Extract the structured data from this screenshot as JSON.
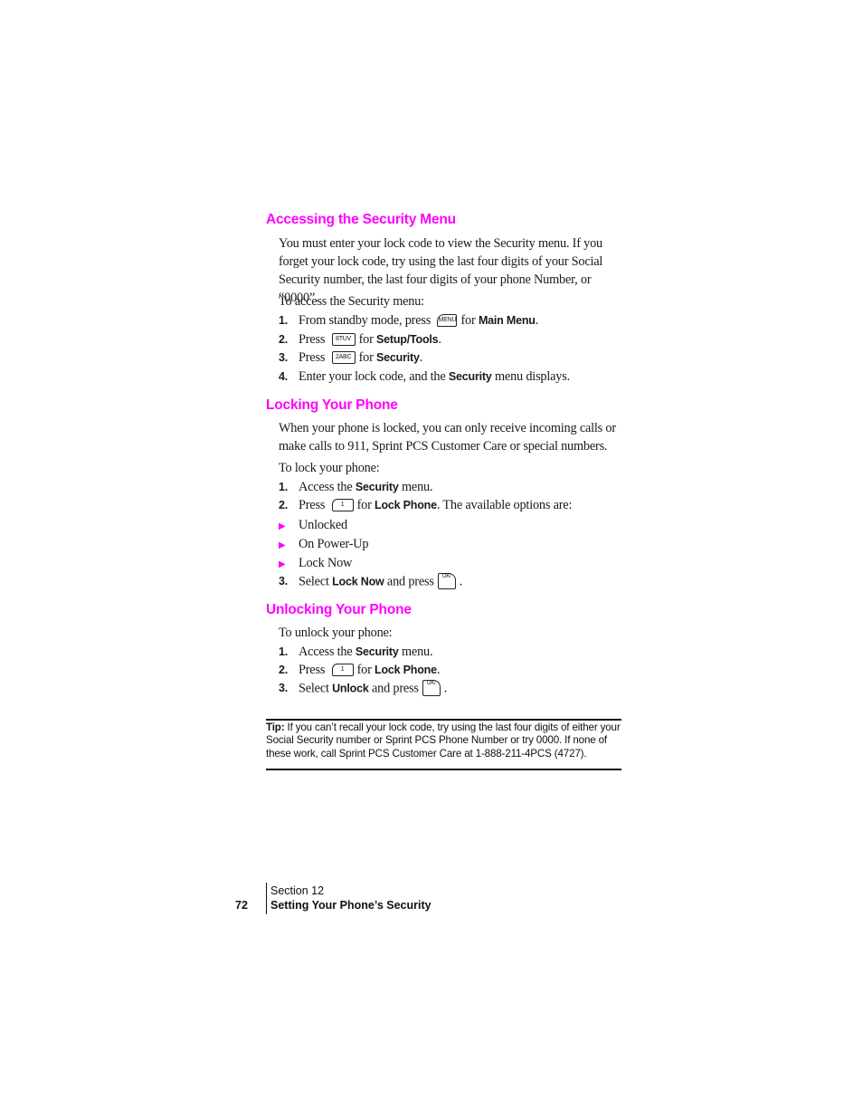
{
  "sections": {
    "accessing": {
      "title": "Accessing the Security Menu",
      "intro": "You must enter your lock code to view the Security menu. If you forget your lock code, try using the last four digits of your Social Security number, the last four digits of your phone Number, or “0000”.",
      "lead": "To access the Security menu:",
      "steps": [
        {
          "num": "1.",
          "pre": "From standby mode, press",
          "key": "MENU",
          "mid": "for",
          "bold": "Main Menu",
          "post": "."
        },
        {
          "num": "2.",
          "pre": "Press",
          "key": "8TUV",
          "mid": "for",
          "bold": "Setup/Tools",
          "post": "."
        },
        {
          "num": "3.",
          "pre": "Press",
          "key": "2ABC",
          "mid": "for",
          "bold": "Security",
          "post": "."
        },
        {
          "num": "4.",
          "pre": "Enter your lock code, and the",
          "bold": "Security",
          "post": "menu displays."
        }
      ]
    },
    "locking": {
      "title": "Locking Your Phone",
      "intro": "When your phone is locked, you can only receive incoming calls or make calls to 911, Sprint PCS Customer Care or special numbers.",
      "lead": "To lock your phone:",
      "steps": [
        {
          "num": "1.",
          "pre": "Access the",
          "bold": "Security",
          "post": "menu."
        },
        {
          "num": "2.",
          "pre": "Press",
          "key": "1",
          "mid": "for",
          "bold": "Lock Phone",
          "post": ". The available options are:"
        },
        {
          "num": "3.",
          "pre": "Select",
          "bold": "Lock Now",
          "mid": "and press",
          "key": "OK/",
          "post": "."
        }
      ],
      "options": [
        "Unlocked",
        "On Power-Up",
        "Lock Now"
      ]
    },
    "unlocking": {
      "title": "Unlocking Your Phone",
      "lead": "To unlock your phone:",
      "steps": [
        {
          "num": "1.",
          "pre": "Access the",
          "bold": "Security",
          "post": "menu."
        },
        {
          "num": "2.",
          "pre": "Press",
          "key": "1",
          "mid": "for",
          "bold": "Lock Phone",
          "post": "."
        },
        {
          "num": "3.",
          "pre": "Select",
          "bold": "Unlock",
          "mid": "and press",
          "key": "OK/",
          "post": "."
        }
      ]
    }
  },
  "tip": {
    "label": "Tip:",
    "text": "If you can’t recall your lock code, try using the last four digits of either your Social Security number or Sprint PCS Phone Number or try 0000. If none of these work, call Sprint PCS Customer Care at 1-888-211-4PCS (4727)."
  },
  "footer": {
    "page_number": "72",
    "section": "Section 12",
    "section_title": "Setting Your Phone’s Security"
  },
  "colors": {
    "heading": "#ff00ff",
    "bullet": "#ff00ff",
    "text": "#1a1a1a"
  }
}
